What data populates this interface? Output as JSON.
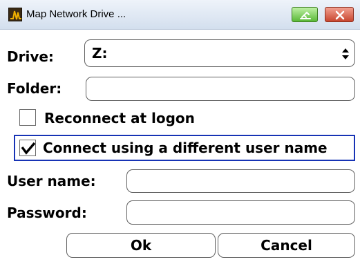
{
  "window": {
    "title": "Map Network Drive ...",
    "icon": "app-waveform-icon",
    "minimize_icon": "minimize-icon",
    "close_icon": "close-icon"
  },
  "form": {
    "drive_label": "Drive:",
    "drive_value": "Z:",
    "folder_label": "Folder:",
    "folder_value": "",
    "reconnect_label": "Reconnect at logon",
    "reconnect_checked": false,
    "diff_user_label": "Connect using a different user name",
    "diff_user_checked": true,
    "username_label": "User name:",
    "username_value": "",
    "password_label": "Password:",
    "password_value": ""
  },
  "buttons": {
    "ok_label": "Ok",
    "cancel_label": "Cancel"
  },
  "colors": {
    "focus_border": "#1733b5",
    "close_button": "#c8462f",
    "minimize_button": "#59b837"
  }
}
